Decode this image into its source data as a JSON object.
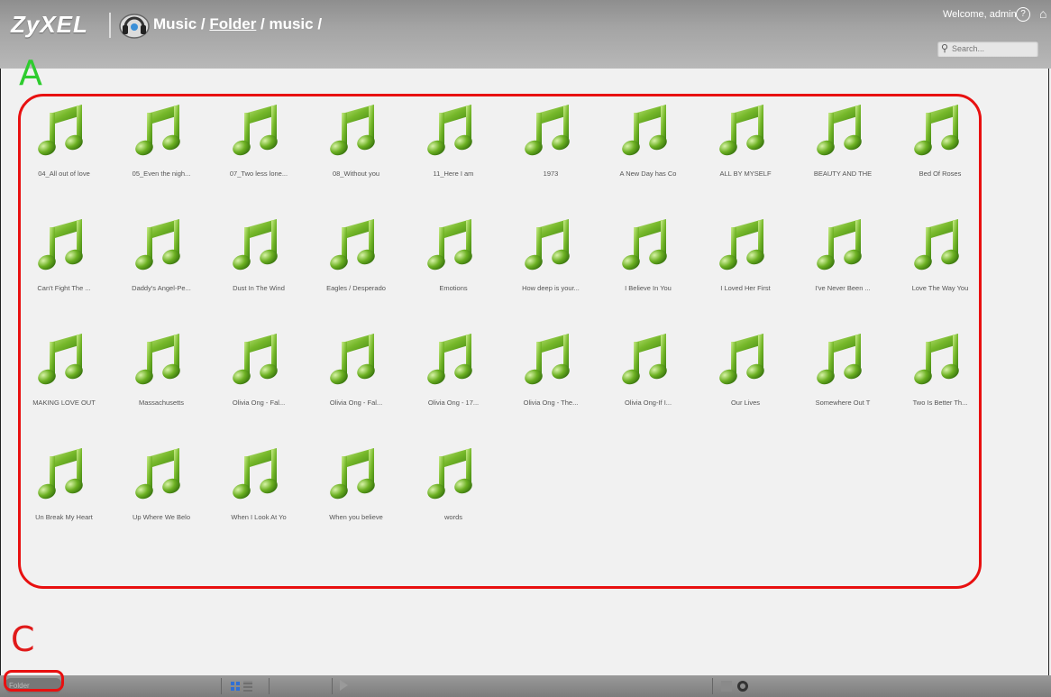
{
  "header": {
    "logo": "ZyXEL",
    "breadcrumb": {
      "part1": "Music / ",
      "link": "Folder",
      "part2": " / music /"
    },
    "welcome": "Welcome, admin",
    "search_placeholder": "Search..."
  },
  "markers": {
    "a": "A",
    "c": "C"
  },
  "files": [
    "04_All out of love",
    "05_Even the nigh...",
    "07_Two less lone...",
    "08_Without you",
    "11_Here I am",
    "1973",
    "A New Day has Co",
    "ALL BY MYSELF",
    "BEAUTY AND THE",
    "Bed Of Roses",
    "Can't Fight The ...",
    "Daddy's Angel-Pe...",
    "Dust In The Wind",
    "Eagles / Desperado",
    "Emotions",
    "How deep is your...",
    "I Believe In You",
    "I Loved Her First",
    "I've Never Been ...",
    "Love The Way You",
    "MAKING LOVE OUT",
    "Massachusetts",
    "Olivia Ong - Fal...",
    "Olivia Ong - Fal...",
    "Olivia Ong - 17...",
    "Olivia Ong - The...",
    "Olivia Ong-If I...",
    "Our Lives",
    "Somewhere Out T",
    "Two Is Better Th...",
    "Un Break My Heart",
    "Up Where We Belo",
    "When I Look At Yo",
    "When you believe",
    "words"
  ],
  "bottombar": {
    "folder_button": "Folder"
  },
  "colors": {
    "note_green": "#5aa617",
    "outline_red": "#e81010",
    "marker_green": "#2ecc2e"
  }
}
